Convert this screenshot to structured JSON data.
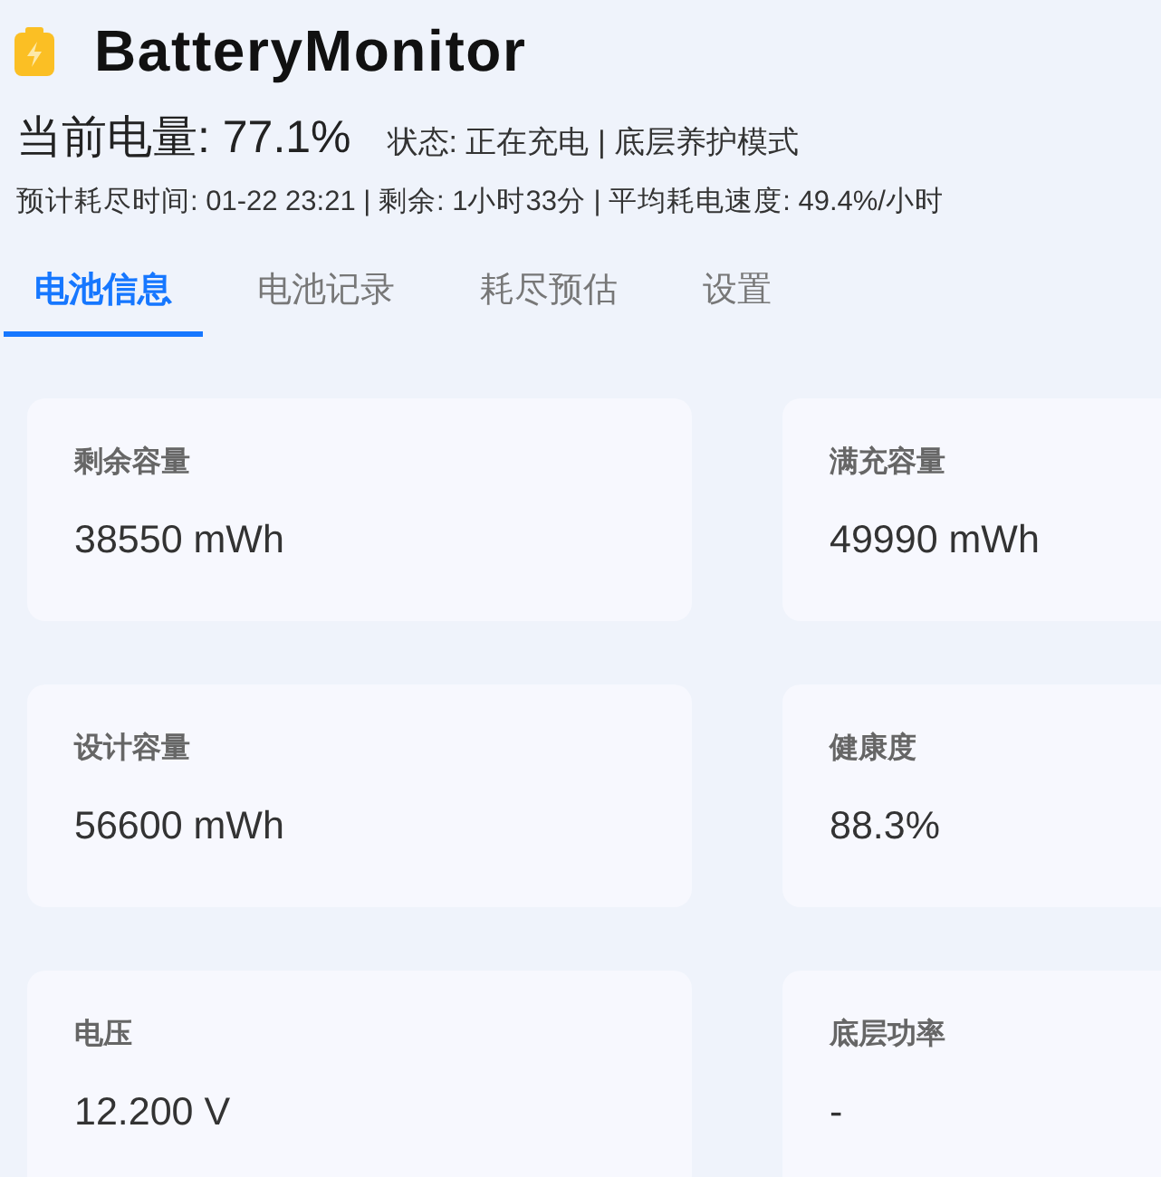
{
  "app": {
    "title": "BatteryMonitor"
  },
  "summary": {
    "charge": "当前电量: 77.1%",
    "status": "状态: 正在充电 | 底层养护模式",
    "estimate": "预计耗尽时间: 01-22 23:21 | 剩余: 1小时33分 | 平均耗电速度: 49.4%/小时"
  },
  "tabs": [
    {
      "label": "电池信息",
      "selected": true
    },
    {
      "label": "电池记录",
      "selected": false
    },
    {
      "label": "耗尽预估",
      "selected": false
    },
    {
      "label": "设置",
      "selected": false
    }
  ],
  "cards": [
    {
      "label": "剩余容量",
      "value": "38550 mWh"
    },
    {
      "label": "满充容量",
      "value": "49990 mWh"
    },
    {
      "label": "设计容量",
      "value": "56600 mWh"
    },
    {
      "label": "健康度",
      "value": "88.3%"
    },
    {
      "label": "电压",
      "value": "12.200 V"
    },
    {
      "label": "底层功率",
      "value": "-"
    }
  ]
}
